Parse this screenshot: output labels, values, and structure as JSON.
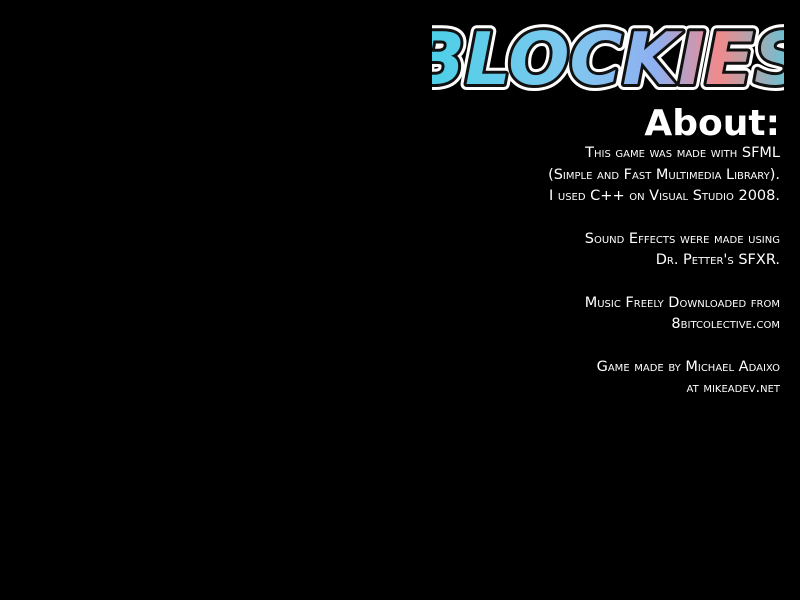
{
  "game": {
    "logo_text": "BLOCKIES",
    "colors": {
      "background": "#000000",
      "text": "#ffffff",
      "logo_cyan": "#45d1e6",
      "logo_blue": "#7fa7f0",
      "logo_pink": "#f08a8c",
      "logo_outline": "#111111"
    }
  },
  "about": {
    "heading": "About:",
    "paragraphs": [
      {
        "lines": [
          "This game was made with SFML",
          "(Simple and Fast Multimedia Library).",
          "I used C++ on Visual Studio 2008."
        ]
      },
      {
        "lines": [
          "Sound Effects were made using",
          "Dr. Petter's SFXR."
        ]
      },
      {
        "lines": [
          "Music Freely Downloaded from",
          "8bitcolective.com"
        ]
      },
      {
        "lines": [
          "Game made by Michael Adaixo",
          "at mikeadev.net"
        ]
      }
    ]
  }
}
